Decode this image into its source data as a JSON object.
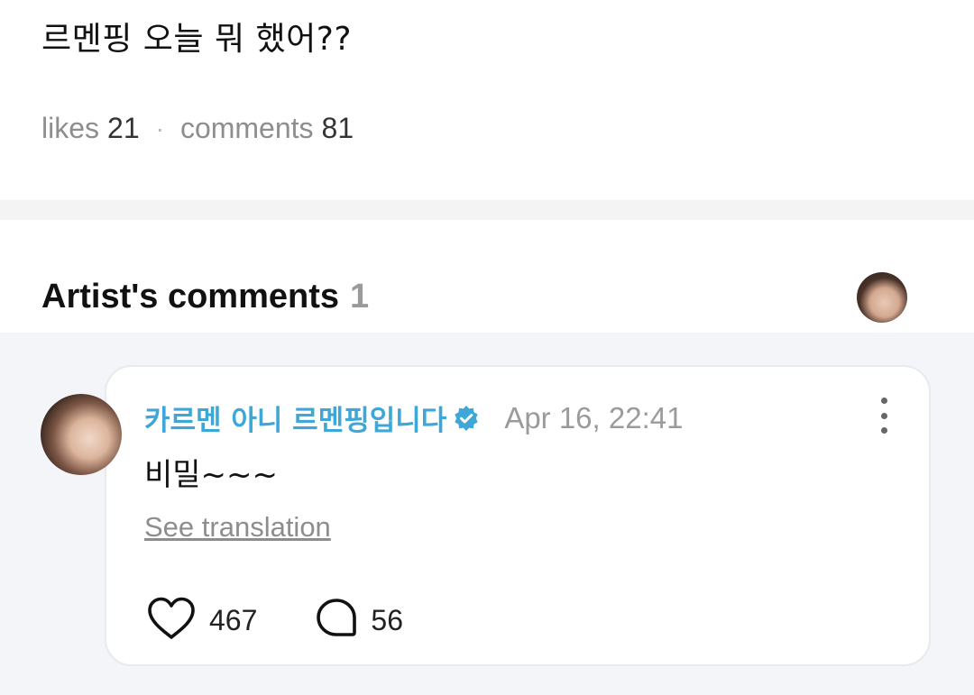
{
  "post": {
    "text": "르멘핑 오늘 뭐 했어??",
    "likes_label": "likes",
    "likes_count": "21",
    "separator": "·",
    "comments_label": "comments",
    "comments_count": "81"
  },
  "artist_comments": {
    "title": "Artist's comments",
    "count": "1"
  },
  "comment": {
    "author": "카르멘 아니 르멘핑입니다",
    "verified_icon": "verified-badge-icon",
    "timestamp": "Apr 16, 22:41",
    "text": "비밀~~~",
    "translation_link": "See translation",
    "like_count": "467",
    "reply_count": "56",
    "more_icon": "more-vertical-icon"
  },
  "colors": {
    "author": "#3ea7d8",
    "verified": "#3ea7d8",
    "muted": "#9b9b9b",
    "band": "#f4f4f5",
    "comments_bg": "#f3f5f8"
  }
}
